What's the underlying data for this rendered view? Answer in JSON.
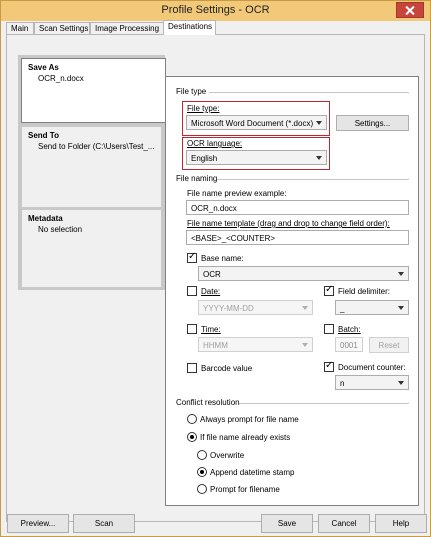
{
  "window": {
    "title": "Profile Settings - OCR"
  },
  "tabs": [
    {
      "label": "Main"
    },
    {
      "label": "Scan Settings"
    },
    {
      "label": "Image Processing"
    },
    {
      "label": "Destinations"
    }
  ],
  "left_panel": {
    "save_as": {
      "title": "Save As",
      "value": "OCR_n.docx"
    },
    "send_to": {
      "title": "Send To",
      "value": "Send to Folder (C:\\Users\\Test_..."
    },
    "metadata": {
      "title": "Metadata",
      "value": "No selection"
    }
  },
  "file_type_section": {
    "heading": "File type",
    "file_type_label": "File type:",
    "file_type_value": "Microsoft Word Document (*.docx)",
    "settings_button": "Settings...",
    "ocr_language_label": "OCR language:",
    "ocr_language_value": "English"
  },
  "file_naming": {
    "heading": "File naming",
    "preview_label": "File name preview example:",
    "preview_value": "OCR_n.docx",
    "template_label": "File name template (drag and drop to change field order):",
    "template_value": "<BASE>_<COUNTER>",
    "base_name_label": "Base name:",
    "base_name_value": "OCR",
    "date_label": "Date:",
    "date_value": "YYYY-MM-DD",
    "field_delimiter_label": "Field delimiter:",
    "field_delimiter_value": "_",
    "time_label": "Time:",
    "time_value": "HHMM",
    "batch_label": "Batch:",
    "batch_value": "0001",
    "reset_button": "Reset",
    "barcode_label": "Barcode value",
    "document_counter_label": "Document counter:",
    "document_counter_value": "n"
  },
  "conflict": {
    "heading": "Conflict resolution",
    "always_prompt": "Always prompt for file name",
    "if_exists": "If file name already exists",
    "overwrite": "Overwrite",
    "append_datetime": "Append datetime stamp",
    "prompt_filename": "Prompt for filename"
  },
  "bottom": {
    "preview": "Preview...",
    "scan": "Scan",
    "save": "Save",
    "cancel": "Cancel",
    "help": "Help"
  }
}
